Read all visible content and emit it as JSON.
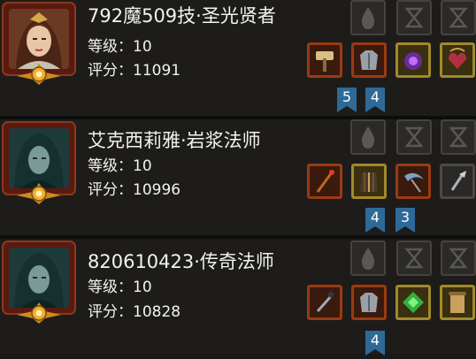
{
  "heroes": [
    {
      "name": "792魔509技·圣光贤者",
      "level_text": "等级：10",
      "score_text": "评分：11091",
      "portrait_icon": "priestess-portrait",
      "slots_top": [
        "drop-rune-icon",
        "hourglass-rune-icon",
        "hourglass-rune-icon"
      ],
      "items": [
        "hammer-icon",
        "armor-icon",
        "purple-orb-icon",
        "heart-amulet-icon"
      ],
      "badges": [
        "5",
        "4"
      ]
    },
    {
      "name": "艾克西莉雅·岩浆法师",
      "level_text": "等级：10",
      "score_text": "评分：10996",
      "portrait_icon": "hooded-mage-portrait",
      "slots_top": [
        "drop-rune-icon",
        "hourglass-rune-icon",
        "hourglass-rune-icon"
      ],
      "items": [
        "staff-icon",
        "robe-icon",
        "scythe-icon",
        "sceptre-icon"
      ],
      "badges": [
        "4",
        "3"
      ]
    },
    {
      "name": "820610423·传奇法师",
      "level_text": "等级：10",
      "score_text": "评分：10828",
      "portrait_icon": "hooded-mage-portrait",
      "slots_top": [
        "drop-rune-icon",
        "hourglass-rune-icon",
        "hourglass-rune-icon"
      ],
      "items": [
        "wand-icon",
        "armor-icon",
        "green-gem-icon",
        "scroll-icon"
      ],
      "badges": [
        "4"
      ]
    }
  ],
  "colors": {
    "background": "#1a1917",
    "text": "#f2f2f0",
    "badge": "#2e6a98",
    "rare_border": "#9a3a12",
    "epic_border": "#a08a2a"
  }
}
